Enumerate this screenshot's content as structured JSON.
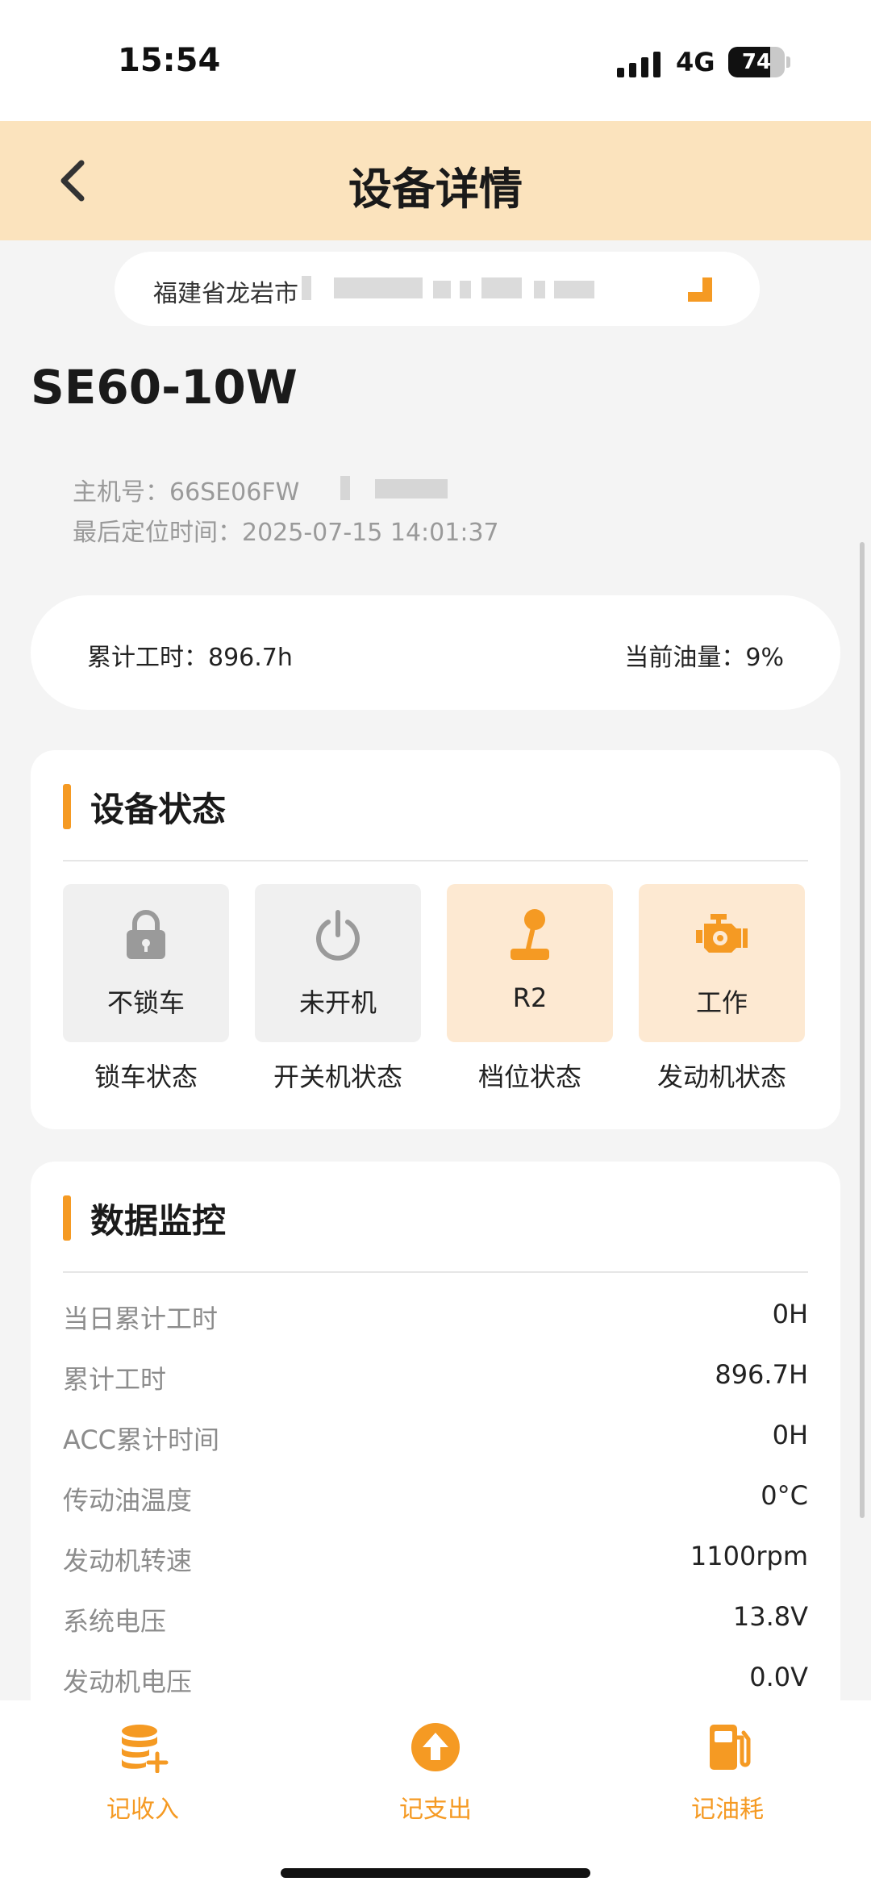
{
  "status_bar": {
    "time": "15:54",
    "network": "4G",
    "battery": "74",
    "battery_level": 0.74
  },
  "nav": {
    "title": "设备详情",
    "back_icon": "chevron-left-icon"
  },
  "address": {
    "text": "福建省龙岩市",
    "icon": "location-arrow-icon"
  },
  "device": {
    "model": "SE60-10W",
    "host_no": "主机号：66SE06FW",
    "last_location_time": "最后定位时间：2025-07-15 14:01:37"
  },
  "summary": {
    "total_hours": "累计工时：896.7h",
    "fuel_level": "当前油量：9%"
  },
  "device_status": {
    "title": "设备状态",
    "tiles": [
      {
        "icon": "lock-icon",
        "value": "不锁车",
        "label": "锁车状态",
        "active": false
      },
      {
        "icon": "power-icon",
        "value": "未开机",
        "label": "开关机状态",
        "active": false
      },
      {
        "icon": "joystick-icon",
        "value": "R2",
        "label": "档位状态",
        "active": true
      },
      {
        "icon": "engine-icon",
        "value": "工作",
        "label": "发动机状态",
        "active": true
      }
    ]
  },
  "data_monitor": {
    "title": "数据监控",
    "rows": [
      {
        "label": "当日累计工时",
        "value": "0H"
      },
      {
        "label": "累计工时",
        "value": "896.7H"
      },
      {
        "label": "ACC累计时间",
        "value": "0H"
      },
      {
        "label": "传动油温度",
        "value": "0°C"
      },
      {
        "label": "发动机转速",
        "value": "1100rpm"
      },
      {
        "label": "系统电压",
        "value": "13.8V"
      },
      {
        "label": "发动机电压",
        "value": "0.0V"
      }
    ]
  },
  "toolbar": {
    "items": [
      {
        "icon": "coins-plus-icon",
        "label": "记收入"
      },
      {
        "icon": "upload-circle-icon",
        "label": "记支出"
      },
      {
        "icon": "fuel-pump-icon",
        "label": "记油耗"
      }
    ]
  },
  "colors": {
    "accent": "#f59a23",
    "nav_bg": "#fbe3bd",
    "tile_active_bg": "#fde9d2",
    "tile_inactive_bg": "#f0f0f0",
    "page_bg": "#f4f4f4"
  }
}
